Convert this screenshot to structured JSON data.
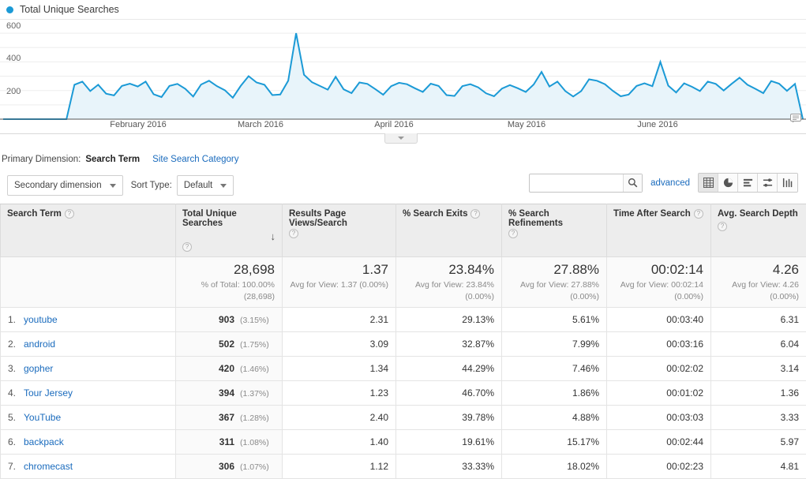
{
  "chart": {
    "legend_label": "Total Unique Searches",
    "legend_color": "#1b9ad6",
    "annotation_icon": "annotation-bubble-icon",
    "collapse_icon": "chevron-down-icon"
  },
  "chart_data": {
    "type": "area",
    "title": "Total Unique Searches",
    "xlabel": "",
    "ylabel": "",
    "ylim": [
      0,
      650
    ],
    "yticks": [
      200,
      400,
      600
    ],
    "ytick_labels": [
      "200",
      "400",
      "600"
    ],
    "xtick_labels": [
      "February 2016",
      "March 2016",
      "April 2016",
      "May 2016",
      "June 2016"
    ],
    "grid": true,
    "legend_position": "top-left",
    "line_color": "#1b9ad6",
    "fill_color": "#e8f4fa",
    "series": [
      {
        "name": "Total Unique Searches",
        "values": [
          0,
          0,
          0,
          0,
          0,
          0,
          0,
          0,
          0,
          240,
          262,
          196,
          240,
          178,
          166,
          232,
          248,
          228,
          262,
          174,
          154,
          232,
          246,
          212,
          158,
          242,
          268,
          230,
          202,
          150,
          232,
          300,
          256,
          240,
          168,
          172,
          268,
          600,
          310,
          258,
          232,
          206,
          296,
          208,
          182,
          256,
          246,
          210,
          170,
          230,
          254,
          244,
          216,
          190,
          248,
          232,
          168,
          162,
          230,
          244,
          222,
          180,
          160,
          214,
          238,
          216,
          190,
          242,
          330,
          228,
          262,
          196,
          158,
          196,
          278,
          268,
          244,
          198,
          160,
          172,
          232,
          250,
          230,
          400,
          234,
          186,
          250,
          226,
          196,
          262,
          246,
          200,
          246,
          290,
          240,
          212,
          182,
          266,
          248,
          198,
          246,
          0
        ]
      }
    ]
  },
  "primary_dimension": {
    "label": "Primary Dimension:",
    "active": "Search Term",
    "other": "Site Search Category"
  },
  "controls": {
    "secondary_dimension": "Secondary dimension",
    "sort_type_label": "Sort Type:",
    "sort_type_value": "Default",
    "search_placeholder": "",
    "search_value": "",
    "search_icon": "magnifier-icon",
    "advanced_label": "advanced",
    "view_icons": [
      {
        "name": "table-view-icon",
        "glyph": "grid",
        "active": true
      },
      {
        "name": "pie-view-icon",
        "glyph": "pie",
        "active": false
      },
      {
        "name": "performance-view-icon",
        "glyph": "bars",
        "active": false
      },
      {
        "name": "comparison-view-icon",
        "glyph": "compare",
        "active": false
      },
      {
        "name": "pivot-view-icon",
        "glyph": "pivot",
        "active": false
      }
    ]
  },
  "table": {
    "columns": [
      {
        "label": "Search Term",
        "help": "?"
      },
      {
        "label": "Total Unique Searches",
        "help": "?",
        "sorted": true,
        "sort_arrow": "↓"
      },
      {
        "label": "Results Page Views/Search",
        "help": "?"
      },
      {
        "label": "% Search Exits",
        "help": "?"
      },
      {
        "label": "% Search Refinements",
        "help": "?"
      },
      {
        "label": "Time After Search",
        "help": "?"
      },
      {
        "label": "Avg. Search Depth",
        "help": "?"
      }
    ],
    "summary": [
      {
        "value": "28,698",
        "note_line1": "% of Total: 100.00%",
        "note_line2": "(28,698)"
      },
      {
        "value": "1.37",
        "note_line1": "Avg for View: 1.37 (0.00%)",
        "note_line2": ""
      },
      {
        "value": "23.84%",
        "note_line1": "Avg for View: 23.84%",
        "note_line2": "(0.00%)"
      },
      {
        "value": "27.88%",
        "note_line1": "Avg for View: 27.88%",
        "note_line2": "(0.00%)"
      },
      {
        "value": "00:02:14",
        "note_line1": "Avg for View: 00:02:14",
        "note_line2": "(0.00%)"
      },
      {
        "value": "4.26",
        "note_line1": "Avg for View: 4.26",
        "note_line2": "(0.00%)"
      }
    ],
    "rows": [
      {
        "index": "1.",
        "term": "youtube",
        "total": "903",
        "pct": "(3.15%)",
        "views": "2.31",
        "exits": "29.13%",
        "refinements": "5.61%",
        "time": "00:03:40",
        "depth": "6.31"
      },
      {
        "index": "2.",
        "term": "android",
        "total": "502",
        "pct": "(1.75%)",
        "views": "3.09",
        "exits": "32.87%",
        "refinements": "7.99%",
        "time": "00:03:16",
        "depth": "6.04"
      },
      {
        "index": "3.",
        "term": "gopher",
        "total": "420",
        "pct": "(1.46%)",
        "views": "1.34",
        "exits": "44.29%",
        "refinements": "7.46%",
        "time": "00:02:02",
        "depth": "3.14"
      },
      {
        "index": "4.",
        "term": "Tour Jersey",
        "total": "394",
        "pct": "(1.37%)",
        "views": "1.23",
        "exits": "46.70%",
        "refinements": "1.86%",
        "time": "00:01:02",
        "depth": "1.36"
      },
      {
        "index": "5.",
        "term": "YouTube",
        "total": "367",
        "pct": "(1.28%)",
        "views": "2.40",
        "exits": "39.78%",
        "refinements": "4.88%",
        "time": "00:03:03",
        "depth": "3.33"
      },
      {
        "index": "6.",
        "term": "backpack",
        "total": "311",
        "pct": "(1.08%)",
        "views": "1.40",
        "exits": "19.61%",
        "refinements": "15.17%",
        "time": "00:02:44",
        "depth": "5.97"
      },
      {
        "index": "7.",
        "term": "chromecast",
        "total": "306",
        "pct": "(1.07%)",
        "views": "1.12",
        "exits": "33.33%",
        "refinements": "18.02%",
        "time": "00:02:23",
        "depth": "4.81"
      }
    ]
  }
}
